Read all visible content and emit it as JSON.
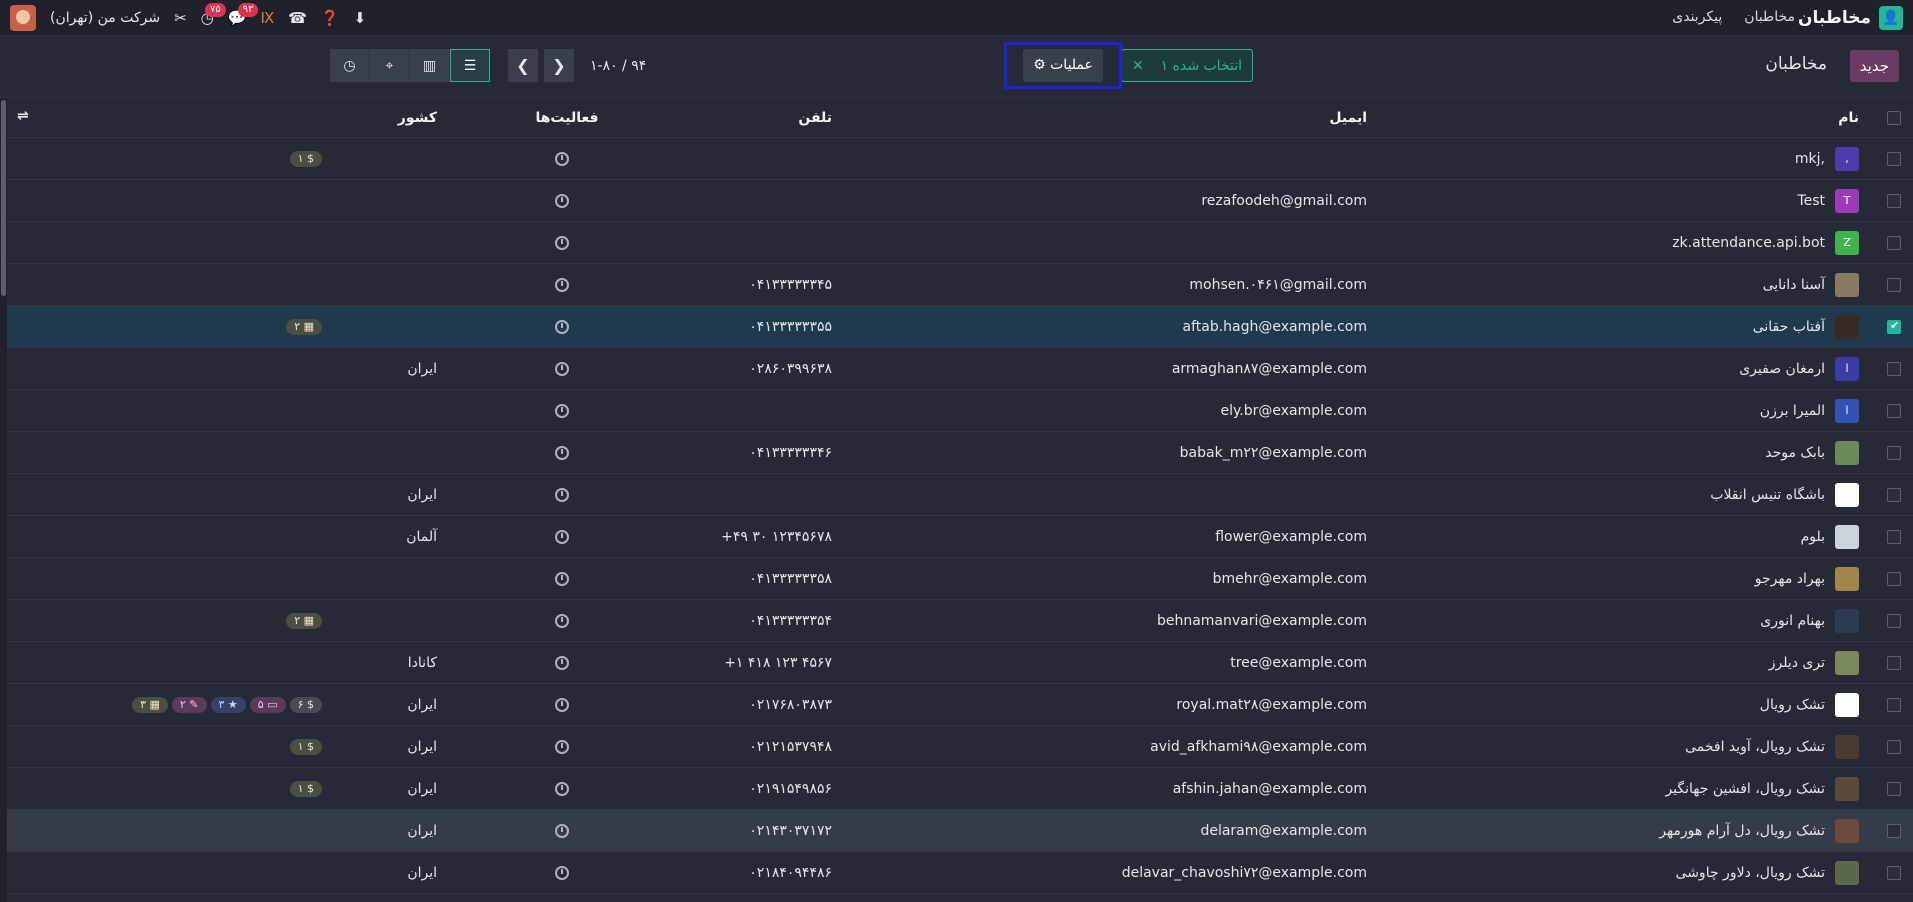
{
  "topbar": {
    "app_title": "مخاطبان",
    "nav": [
      "مخاطبان",
      "پیکربندی"
    ],
    "company": "شرکت من (تهران)",
    "badges": {
      "activities": "۷۵",
      "messages": "۹۳"
    }
  },
  "control_panel": {
    "new_label": "جدید",
    "breadcrumb": "مخاطبان",
    "selected_label": "۱ انتخاب شده",
    "actions_label": "عملیات",
    "pager_value": "۱-۸۰ / ۹۴"
  },
  "columns": {
    "name": "نام",
    "email": "ایمیل",
    "phone": "تلفن",
    "activities": "فعالیت‌ها",
    "country": "کشور"
  },
  "rows": [
    {
      "name": "mkj,",
      "email": "",
      "phone": "",
      "country": "",
      "avatar_letter": ",",
      "avatar_color": "#4b3cb0",
      "tags": [
        "۱ $"
      ]
    },
    {
      "name": "Test",
      "email": "rezafoodeh@gmail.com",
      "phone": "",
      "country": "",
      "avatar_letter": "T",
      "avatar_color": "#9c3ab8",
      "tags": []
    },
    {
      "name": "zk.attendance.api.bot",
      "email": "",
      "phone": "",
      "country": "",
      "avatar_letter": "Z",
      "avatar_color": "#40b34f",
      "tags": []
    },
    {
      "name": "آسنا دانایی",
      "email": "mohsen.۰۴۶۱@gmail.com",
      "phone": "۰۴۱۳۳۳۳۳۳۴۵",
      "country": "",
      "avatar_letter": "",
      "avatar_color": "#8a7a60",
      "tags": []
    },
    {
      "name": "آفتاب حقانی",
      "email": "aftab.hagh@example.com",
      "phone": "۰۴۱۳۳۳۳۳۳۵۵",
      "country": "",
      "avatar_letter": "",
      "avatar_color": "#3a2a26",
      "tags": [
        "۲ ▦"
      ],
      "selected": true
    },
    {
      "name": "ارمغان صفیری",
      "email": "armaghan۸۷@example.com",
      "phone": "۰۲۸۶۰۳۹۹۶۳۸",
      "country": "ایران",
      "avatar_letter": "ا",
      "avatar_color": "#3b3ca8",
      "tags": []
    },
    {
      "name": "المیرا برزن",
      "email": "ely.br@example.com",
      "phone": "",
      "country": "",
      "avatar_letter": "ا",
      "avatar_color": "#3153b8",
      "tags": []
    },
    {
      "name": "بابک موحد",
      "email": "babak_m۲۲@example.com",
      "phone": "۰۴۱۳۳۳۳۳۳۴۶",
      "country": "",
      "avatar_letter": "",
      "avatar_color": "#6a8a5a",
      "tags": []
    },
    {
      "name": "باشگاه تنیس انقلاب",
      "email": "",
      "phone": "",
      "country": "ایران",
      "avatar_letter": "",
      "avatar_color": "#ffffff",
      "tags": []
    },
    {
      "name": "بلوم",
      "email": "flower@example.com",
      "phone": "+۴۹ ۳۰ ۱۲۳۴۵۶۷۸",
      "country": "آلمان",
      "avatar_letter": "",
      "avatar_color": "#c9d4dc",
      "tags": []
    },
    {
      "name": "بهراد مهرجو",
      "email": "bmehr@example.com",
      "phone": "۰۴۱۳۳۳۳۳۳۵۸",
      "country": "",
      "avatar_letter": "",
      "avatar_color": "#a0874a",
      "tags": []
    },
    {
      "name": "بهنام انوری",
      "email": "behnamanvari@example.com",
      "phone": "۰۴۱۳۳۳۳۳۳۵۴",
      "country": "",
      "avatar_letter": "",
      "avatar_color": "#2c3b4f",
      "tags": [
        "۲ ▦"
      ]
    },
    {
      "name": "تری دیلرز",
      "email": "tree@example.com",
      "phone": "+۱ ۴۱۸ ۱۲۳ ۴۵۶۷",
      "country": "کانادا",
      "avatar_letter": "",
      "avatar_color": "#7a8a5a",
      "tags": []
    },
    {
      "name": "تشک رویال",
      "email": "royal.mat۲۸@example.com",
      "phone": "۰۲۱۷۶۸۰۳۸۷۳",
      "country": "ایران",
      "avatar_letter": "",
      "avatar_color": "#ffffff",
      "tags": [
        "۳ ▦",
        "۲ ✎",
        "۳ ★",
        "۵ ▭",
        "۶ $"
      ]
    },
    {
      "name": "تشک رویال، آوید افخمی",
      "email": "avid_afkhami۹۸@example.com",
      "phone": "۰۲۱۲۱۵۳۷۹۴۸",
      "country": "ایران",
      "avatar_letter": "",
      "avatar_color": "#4a3b30",
      "tags": [
        "۱ $"
      ]
    },
    {
      "name": "تشک رویال، افشین جهانگیر",
      "email": "afshin.jahan@example.com",
      "phone": "۰۲۱۹۱۵۴۹۸۵۶",
      "country": "ایران",
      "avatar_letter": "",
      "avatar_color": "#5a4a3a",
      "tags": [
        "۱ $"
      ]
    },
    {
      "name": "تشک رویال، دل آرام هورمهر",
      "email": "delaram@example.com",
      "phone": "۰۲۱۴۳۰۳۷۱۷۲",
      "country": "ایران",
      "avatar_letter": "",
      "avatar_color": "#6a4a3a",
      "tags": [],
      "hovered": true
    },
    {
      "name": "تشک رویال، دلاور چاوشی",
      "email": "delavar_chavoshi۷۲@example.com",
      "phone": "۰۲۱۸۴۰۹۴۴۸۶",
      "country": "ایران",
      "avatar_letter": "",
      "avatar_color": "#5a6a4a",
      "tags": []
    }
  ]
}
